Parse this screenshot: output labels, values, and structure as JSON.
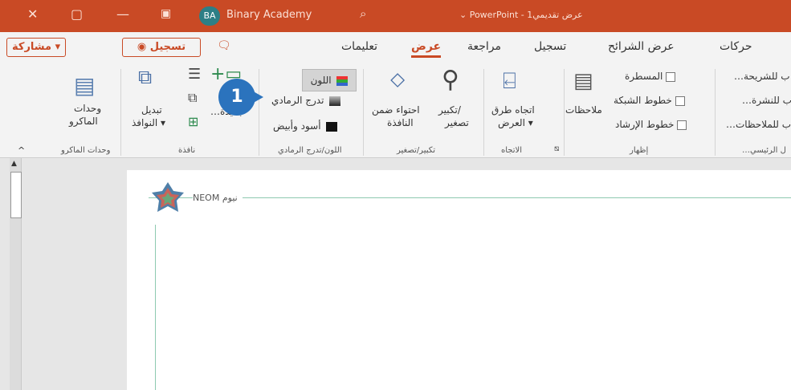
{
  "titlebar": {
    "close": "✕",
    "restore": "▢",
    "minimize": "—",
    "user_initials": "BA",
    "user_name": "Binary Academy",
    "document_title": "⌄ PowerPoint - 1عرض تقديمي"
  },
  "tabs": [
    "حركات",
    "عرض الشرائح",
    "تسجيل",
    "مراجعة",
    "عرض",
    "تعليمات"
  ],
  "active_tab": "عرض",
  "actions": {
    "share": "مشاركة ▾",
    "record": "◉ تسجيل"
  },
  "ribbon": {
    "master_views": [
      "…ب للشريحة",
      "…ب للنشرة",
      "…ب للملاحظات"
    ],
    "master_group_label": "…ل الرئيسي",
    "show": {
      "items": [
        "المسطرة",
        "خطوط الشبكة",
        "خطوط الإرشاد"
      ],
      "notes": "ملاحظات",
      "label": "إظهار"
    },
    "direction": {
      "button": [
        "اتجاه طرق",
        "العرض ▾"
      ],
      "label": "الاتجاه"
    },
    "zoom": {
      "zoom_btn": [
        "تكبير/",
        "تصغير"
      ],
      "fit_btn": [
        "احتواء ضمن",
        "النافذة"
      ],
      "label": "تكبير/تصغير"
    },
    "color": {
      "color": "اللون",
      "grayscale": "تدرج الرمادي",
      "bw": "أسود وأبيض",
      "label": "اللون/تدرج الرمادي"
    },
    "window": {
      "new": "…جديدة",
      "switch": [
        "تبديل",
        "النوافذ ▾"
      ],
      "label": "نافذة"
    },
    "macros": {
      "button": [
        "وحدات",
        "الماكرو"
      ],
      "label": "وحدات الماكرو"
    }
  },
  "callout_number": "1",
  "slide": {
    "logo_text": "NEOM نيوم"
  },
  "colors": {
    "accent": "#c94a25",
    "callout": "#2b73bd",
    "guide": "#8ec9b0"
  }
}
